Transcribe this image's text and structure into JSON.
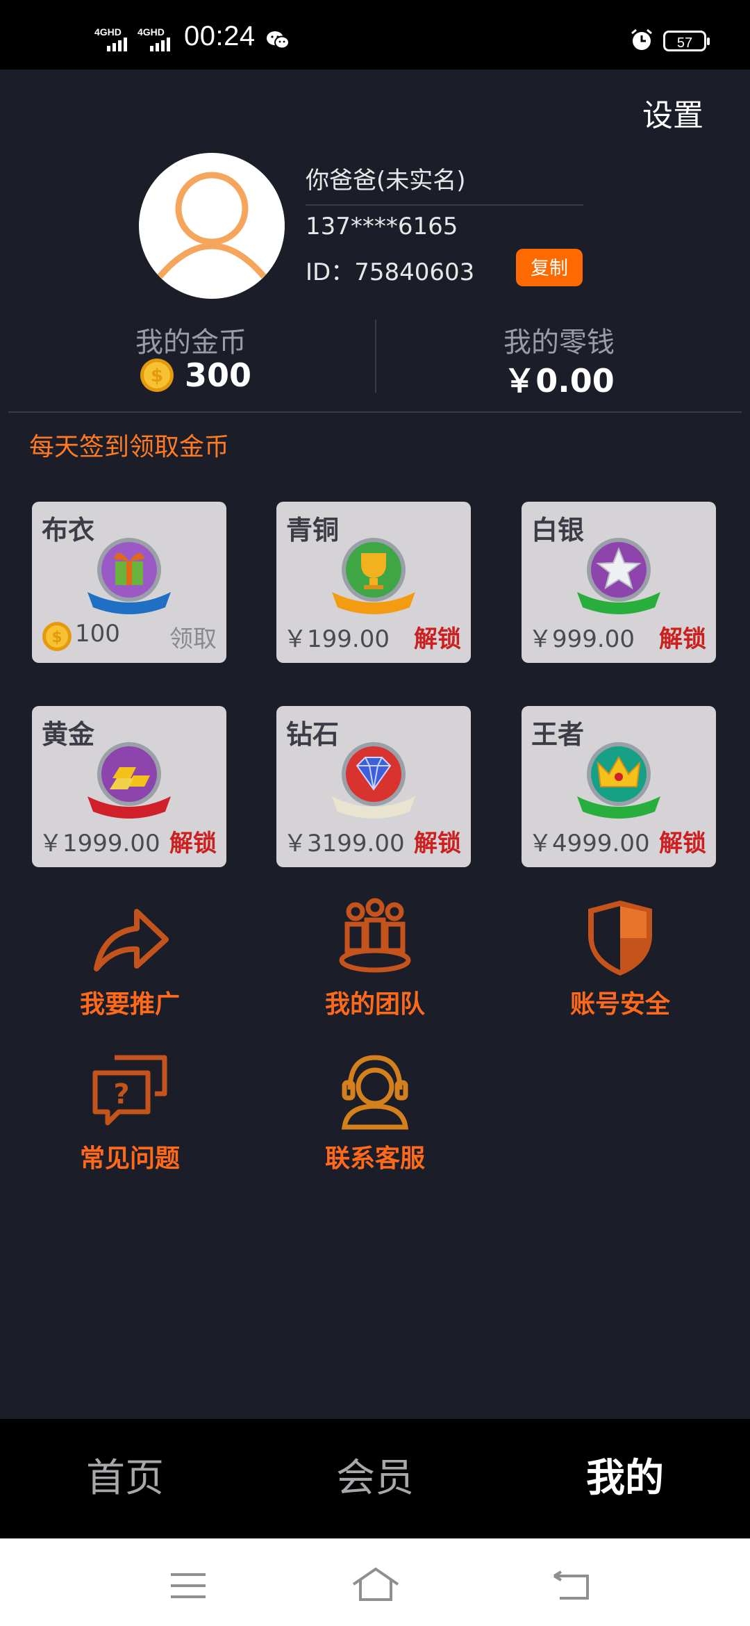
{
  "status_bar": {
    "time": "00:24",
    "signal1_label": "4GHD",
    "signal2_label": "4GHD",
    "battery": "57",
    "icons": [
      "wechat-icon",
      "alarm-icon"
    ]
  },
  "header": {
    "settings_label": "设置",
    "username": "你爸爸(未实名)",
    "phone": "137****6165",
    "id_text": "ID：75840603",
    "copy_label": "复制"
  },
  "stats": {
    "coins_label": "我的金币",
    "coins_value": "300",
    "cash_label": "我的零钱",
    "cash_value": "￥0.00"
  },
  "checkin_text": "每天签到领取金币",
  "levels": [
    {
      "title": "布衣",
      "price": "100",
      "action": "领取",
      "icon": "gift-badge-icon"
    },
    {
      "title": "青铜",
      "price": "￥199.00",
      "action": "解锁",
      "icon": "trophy-badge-icon"
    },
    {
      "title": "白银",
      "price": "￥999.00",
      "action": "解锁",
      "icon": "star-badge-icon"
    },
    {
      "title": "黄金",
      "price": "￥1999.00",
      "action": "解锁",
      "icon": "gold-bars-badge-icon"
    },
    {
      "title": "钻石",
      "price": "￥3199.00",
      "action": "解锁",
      "icon": "diamond-badge-icon"
    },
    {
      "title": "王者",
      "price": "￥4999.00",
      "action": "解锁",
      "icon": "crown-badge-icon"
    }
  ],
  "menu": [
    {
      "label": "我要推广",
      "icon": "share-arrow-icon"
    },
    {
      "label": "我的团队",
      "icon": "team-icon"
    },
    {
      "label": "账号安全",
      "icon": "shield-icon"
    },
    {
      "label": "常见问题",
      "icon": "faq-chat-icon"
    },
    {
      "label": "联系客服",
      "icon": "customer-service-icon"
    }
  ],
  "tabs": [
    {
      "label": "首页",
      "active": false
    },
    {
      "label": "会员",
      "active": false
    },
    {
      "label": "我的",
      "active": true
    }
  ],
  "colors": {
    "background": "#1b1d28",
    "accent": "#ff6a1a",
    "unlock_red": "#cc1f1f",
    "card": "#d5d3d6"
  }
}
